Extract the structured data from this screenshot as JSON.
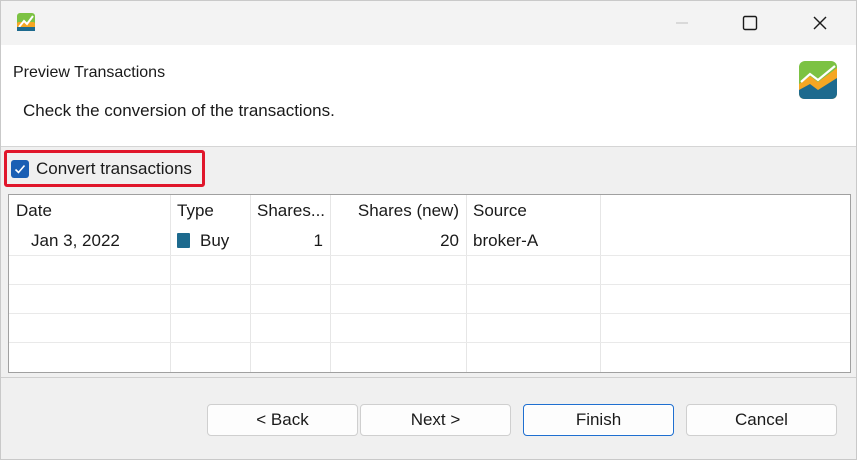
{
  "window": {
    "app_icon": "portfolio-chart-icon",
    "controls": [
      "minimize-icon",
      "maximize-icon",
      "close-icon"
    ]
  },
  "header": {
    "title": "Preview Transactions",
    "description": "Check the conversion of the transactions."
  },
  "options": {
    "convert_label": "Convert transactions",
    "convert_checked": true,
    "highlight_color": "#e0162b"
  },
  "table": {
    "columns": [
      "Date",
      "Type",
      "Shares...",
      "Shares (new)",
      "Source"
    ],
    "rows": [
      {
        "date": "Jan 3, 2022",
        "type": "Buy",
        "type_icon": "buy-icon",
        "shares": "1",
        "shares_new": "20",
        "source": "broker-A"
      }
    ]
  },
  "buttons": {
    "back": "< Back",
    "next": "Next >",
    "finish": "Finish",
    "cancel": "Cancel"
  }
}
